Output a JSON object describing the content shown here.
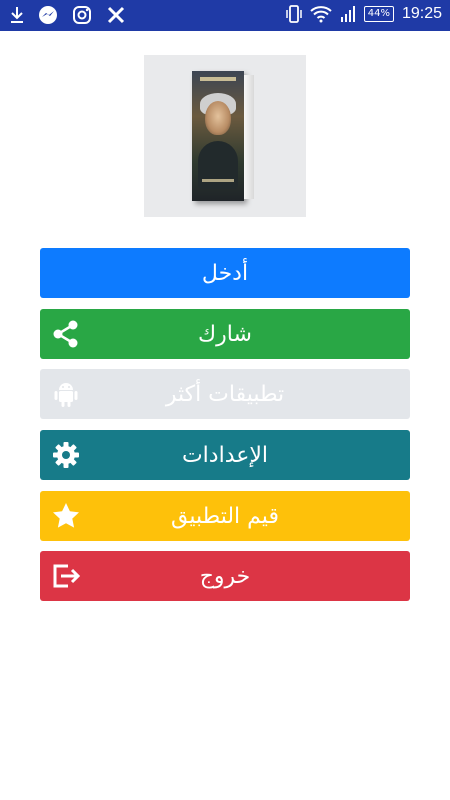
{
  "status_bar": {
    "time": "19:25",
    "battery": "44%",
    "left_icons": [
      "download-icon",
      "messenger-icon",
      "instagram-icon",
      "x-icon"
    ],
    "right_icons": [
      "vibrate-icon",
      "wifi-icon",
      "signal-icon",
      "battery-icon"
    ]
  },
  "cover": {
    "alt": "book-cover"
  },
  "menu": {
    "enter_label": "أدخل",
    "share_label": "شارك",
    "more_apps_label": "تطبيقات أكثر",
    "settings_label": "الإعدادات",
    "rate_label": "قيم التطبيق",
    "exit_label": "خروج"
  },
  "colors": {
    "status_bar": "#1f3aa6",
    "enter": "#0d7bff",
    "share": "#29a745",
    "more_apps": "#e3e6ea",
    "settings": "#177b89",
    "rate": "#fec10a",
    "exit": "#dc3545"
  }
}
